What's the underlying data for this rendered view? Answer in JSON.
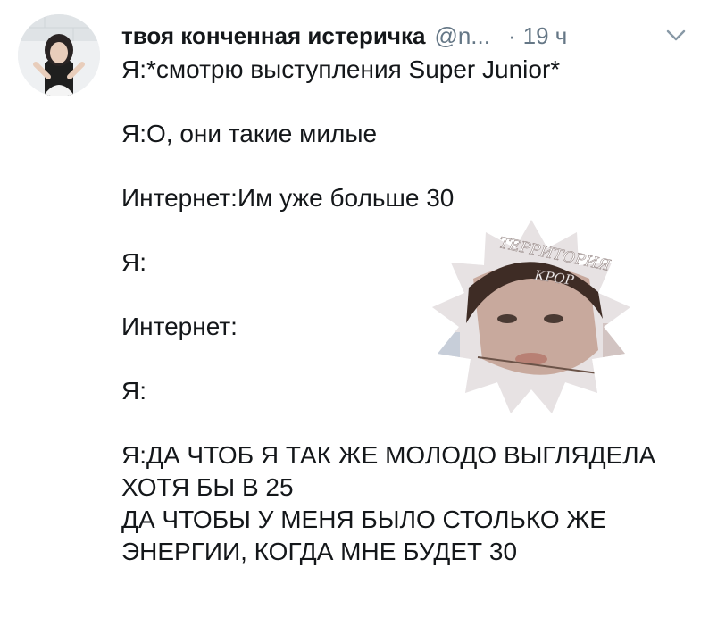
{
  "tweet": {
    "author_name": "твоя конченная истеричка",
    "handle": "@n...",
    "separator": "·",
    "time": "19 ч",
    "lines": {
      "l1": "Я:*смотрю выступления Super Junior*",
      "l2": "Я:О, они такие милые",
      "l3": "Интернет:Им уже больше 30",
      "l4": "Я:",
      "l5": "Интернет:",
      "l6": "Я:",
      "l7": "Я:ДА ЧТОБ Я ТАК ЖЕ МОЛОДО ВЫГЛЯДЕЛА",
      "l8": "ХОТЯ БЫ В 25",
      "l9": "ДА ЧТОБЫ У МЕНЯ БЫЛО СТОЛЬКО ЖЕ",
      "l10": "ЭНЕРГИИ, КОГДА МНЕ БУДЕТ 30"
    }
  },
  "watermark": {
    "line1": "ТЕРРИТОРИЯ",
    "line2": "КРОР"
  },
  "icons": {
    "more": "chevron-down-icon",
    "avatar": "avatar"
  },
  "colors": {
    "text": "#14171a",
    "secondary": "#657786",
    "watermark_text": "#ffffff"
  }
}
